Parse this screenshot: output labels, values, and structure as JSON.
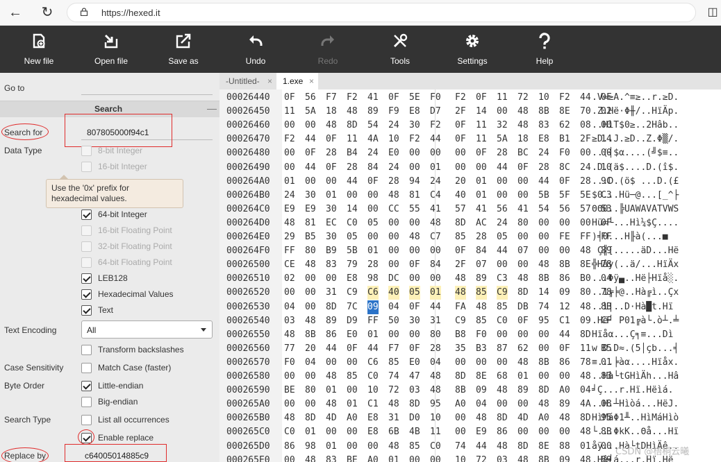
{
  "browser": {
    "url": "https://hexed.it"
  },
  "toolbar": {
    "buttons": [
      {
        "label": "New file",
        "icon": "new-file-icon",
        "disabled": false
      },
      {
        "label": "Open file",
        "icon": "open-file-icon",
        "disabled": false
      },
      {
        "label": "Save as",
        "icon": "save-as-icon",
        "disabled": false
      },
      {
        "label": "Undo",
        "icon": "undo-icon",
        "disabled": false
      },
      {
        "label": "Redo",
        "icon": "redo-icon",
        "disabled": true
      },
      {
        "label": "Tools",
        "icon": "tools-icon",
        "disabled": false
      },
      {
        "label": "Settings",
        "icon": "gear-icon",
        "disabled": false
      },
      {
        "label": "Help",
        "icon": "help-icon",
        "disabled": false
      }
    ]
  },
  "sidebar": {
    "goto_label": "Go to",
    "search_section": "Search",
    "collapse_symbol": "—",
    "search_for_label": "Search for",
    "search_for_value": "807805000f94c1",
    "data_type_label": "Data Type",
    "tooltip": "Use the '0x' prefix for hexadecimal values.",
    "data_types": [
      {
        "label": "8-bit Integer",
        "checked": false,
        "disabled": true
      },
      {
        "label": "16-bit Integer",
        "checked": false,
        "disabled": true
      },
      {
        "label": "64-bit Integer",
        "checked": true,
        "disabled": false
      },
      {
        "label": "16-bit Floating Point",
        "checked": false,
        "disabled": true
      },
      {
        "label": "32-bit Floating Point",
        "checked": false,
        "disabled": true
      },
      {
        "label": "64-bit Floating Point",
        "checked": false,
        "disabled": true
      },
      {
        "label": "LEB128",
        "checked": true,
        "disabled": false
      },
      {
        "label": "Hexadecimal Values",
        "checked": true,
        "disabled": false
      },
      {
        "label": "Text",
        "checked": true,
        "disabled": false
      }
    ],
    "text_encoding_label": "Text Encoding",
    "text_encoding_value": "All",
    "transform_backslashes": "Transform backslashes",
    "case_sensitivity_label": "Case Sensitivity",
    "match_case": "Match Case (faster)",
    "byte_order_label": "Byte Order",
    "little_endian": "Little-endian",
    "big_endian": "Big-endian",
    "search_type_label": "Search Type",
    "list_all": "List all occurrences",
    "enable_replace": "Enable replace",
    "replace_by_label": "Replace by",
    "replace_by_value": "c64005014885c9"
  },
  "tabs": [
    {
      "label": "-Untitled-",
      "close": "×"
    },
    {
      "label": "1.exe",
      "close": "×"
    }
  ],
  "hex": {
    "rows": [
      {
        "addr": "00026440",
        "bytes": [
          "0F",
          "56",
          "F7",
          "F2",
          "41",
          "0F",
          "5E",
          "F0",
          "F2",
          "0F",
          "11",
          "72",
          "10",
          "F2",
          "44",
          "0F"
        ],
        "ascii": ".V≈≥A.^≡≥..r.≥D."
      },
      {
        "addr": "00026450",
        "bytes": [
          "11",
          "5A",
          "18",
          "48",
          "89",
          "F9",
          "E8",
          "D7",
          "2F",
          "14",
          "00",
          "48",
          "8B",
          "8E",
          "70",
          "02"
        ],
        "ascii": ".Z.Hë·Φ╫/..HïÄp."
      },
      {
        "addr": "00026460",
        "bytes": [
          "00",
          "00",
          "48",
          "8D",
          "54",
          "24",
          "30",
          "F2",
          "0F",
          "11",
          "32",
          "48",
          "83",
          "62",
          "08",
          "00"
        ],
        "ascii": "..HìT$0≥..2Hâb.."
      },
      {
        "addr": "00026470",
        "bytes": [
          "F2",
          "44",
          "0F",
          "11",
          "4A",
          "10",
          "F2",
          "44",
          "0F",
          "11",
          "5A",
          "18",
          "E8",
          "B1",
          "2F",
          "14"
        ],
        "ascii": "≥D..J.≥D..Z.Φ▒/."
      },
      {
        "addr": "00026480",
        "bytes": [
          "00",
          "0F",
          "28",
          "B4",
          "24",
          "E0",
          "00",
          "00",
          "00",
          "0F",
          "28",
          "BC",
          "24",
          "F0",
          "00",
          "00"
        ],
        "ascii": "..(┤$α....(╝$≡.."
      },
      {
        "addr": "00026490",
        "bytes": [
          "00",
          "44",
          "0F",
          "28",
          "84",
          "24",
          "00",
          "01",
          "00",
          "00",
          "44",
          "0F",
          "28",
          "8C",
          "24",
          "10"
        ],
        "ascii": ".D.(ä$....D.(î$."
      },
      {
        "addr": "000264A0",
        "bytes": [
          "01",
          "00",
          "00",
          "44",
          "0F",
          "28",
          "94",
          "24",
          "20",
          "01",
          "00",
          "00",
          "44",
          "0F",
          "28",
          "9C"
        ],
        "ascii": "...D.(ö$ ...D.(£"
      },
      {
        "addr": "000264B0",
        "bytes": [
          "24",
          "30",
          "01",
          "00",
          "00",
          "48",
          "81",
          "C4",
          "40",
          "01",
          "00",
          "00",
          "5B",
          "5F",
          "5E",
          "C3"
        ],
        "ascii": "$0...Hü─@...[_^├"
      },
      {
        "addr": "000264C0",
        "bytes": [
          "E9",
          "E9",
          "30",
          "14",
          "00",
          "CC",
          "55",
          "41",
          "57",
          "41",
          "56",
          "41",
          "54",
          "56",
          "57",
          "53"
        ],
        "ascii": "ΘΘ0..╠UAWAVATVWS"
      },
      {
        "addr": "000264D0",
        "bytes": [
          "48",
          "81",
          "EC",
          "C0",
          "05",
          "00",
          "00",
          "48",
          "8D",
          "AC",
          "24",
          "80",
          "00",
          "00",
          "00",
          "0F"
        ],
        "ascii": "Hü∞└...Hì¼$Ç...."
      },
      {
        "addr": "000264E0",
        "bytes": [
          "29",
          "B5",
          "30",
          "05",
          "00",
          "00",
          "48",
          "C7",
          "85",
          "28",
          "05",
          "00",
          "00",
          "FE",
          "FF",
          "FF"
        ],
        "ascii": ")╡0...H╟à(...■  "
      },
      {
        "addr": "000264F0",
        "bytes": [
          "FF",
          "80",
          "B9",
          "5B",
          "01",
          "00",
          "00",
          "00",
          "0F",
          "84",
          "44",
          "07",
          "00",
          "00",
          "48",
          "89"
        ],
        "ascii": " Ç╣[.....äD...Hë"
      },
      {
        "addr": "00026500",
        "bytes": [
          "CE",
          "48",
          "83",
          "79",
          "28",
          "00",
          "0F",
          "84",
          "2F",
          "07",
          "00",
          "00",
          "48",
          "8B",
          "8E",
          "78"
        ],
        "ascii": "╬Hây(..ä/...HïÄx"
      },
      {
        "addr": "00026510",
        "bytes": [
          "02",
          "00",
          "00",
          "E8",
          "98",
          "DC",
          "00",
          "00",
          "48",
          "89",
          "C3",
          "48",
          "8B",
          "86",
          "B0",
          "04"
        ],
        "ascii": "...Φÿ▄..Hë├Hïå░."
      },
      {
        "addr": "00026520",
        "bytes": [
          "00",
          "00",
          "31",
          "C9",
          "C6",
          "40",
          "05",
          "01",
          "48",
          "85",
          "C9",
          "8D",
          "14",
          "09",
          "80",
          "78"
        ],
        "ascii": "..1╔╞@..Hà╔ì..Çx"
      },
      {
        "addr": "00026530",
        "bytes": [
          "04",
          "00",
          "8D",
          "7C",
          "09",
          "04",
          "0F",
          "44",
          "FA",
          "48",
          "85",
          "DB",
          "74",
          "12",
          "48",
          "8B"
        ],
        "ascii": "..ì|..D·Hà█t.Hï"
      },
      {
        "addr": "00026540",
        "bytes": [
          "03",
          "48",
          "89",
          "D9",
          "FF",
          "50",
          "30",
          "31",
          "C9",
          "85",
          "C0",
          "0F",
          "95",
          "C1",
          "09",
          "CF"
        ],
        "ascii": ".Hë┘ P01╔à└.ò┴.╧"
      },
      {
        "addr": "00026550",
        "bytes": [
          "48",
          "8B",
          "86",
          "E0",
          "01",
          "00",
          "00",
          "80",
          "B8",
          "F0",
          "00",
          "00",
          "00",
          "44",
          "8D"
        ],
        "ascii": "Hïåα...Ç╕≡...Dì"
      },
      {
        "addr": "00026560",
        "bytes": [
          "77",
          "20",
          "44",
          "0F",
          "44",
          "F7",
          "0F",
          "28",
          "35",
          "B3",
          "87",
          "62",
          "00",
          "0F",
          "11",
          "B5"
        ],
        "ascii": "w D.D≈.(5│çb...╡"
      },
      {
        "addr": "00026570",
        "bytes": [
          "F0",
          "04",
          "00",
          "00",
          "C6",
          "85",
          "E0",
          "04",
          "00",
          "00",
          "00",
          "48",
          "8B",
          "86",
          "78",
          "01"
        ],
        "ascii": "≡...╞àα....Hïåx."
      },
      {
        "addr": "00026580",
        "bytes": [
          "00",
          "00",
          "48",
          "85",
          "C0",
          "74",
          "47",
          "48",
          "8D",
          "8E",
          "68",
          "01",
          "00",
          "00",
          "48",
          "83"
        ],
        "ascii": "..Hà└tGHìÄh...Hâ"
      },
      {
        "addr": "00026590",
        "bytes": [
          "BE",
          "80",
          "01",
          "00",
          "10",
          "72",
          "03",
          "48",
          "8B",
          "09",
          "48",
          "89",
          "8D",
          "A0",
          "04"
        ],
        "ascii": "╛Ç...r.Hï.Hëìá."
      },
      {
        "addr": "000265A0",
        "bytes": [
          "00",
          "00",
          "48",
          "01",
          "C1",
          "48",
          "8D",
          "95",
          "A0",
          "04",
          "00",
          "00",
          "48",
          "89",
          "4A",
          "08"
        ],
        "ascii": "..H.┴Hìòá...HëJ."
      },
      {
        "addr": "000265B0",
        "bytes": [
          "48",
          "8D",
          "4D",
          "A0",
          "E8",
          "31",
          "D0",
          "10",
          "00",
          "48",
          "8D",
          "4D",
          "A0",
          "48",
          "8D",
          "95"
        ],
        "ascii": "HìMáΦ1╨..HìMáHìò"
      },
      {
        "addr": "000265C0",
        "bytes": [
          "C0",
          "01",
          "00",
          "00",
          "E8",
          "6B",
          "4B",
          "11",
          "00",
          "E9",
          "86",
          "00",
          "00",
          "00",
          "48",
          "8B"
        ],
        "ascii": "└...ΦkK..Θå...Hï"
      },
      {
        "addr": "000265D0",
        "bytes": [
          "86",
          "98",
          "01",
          "00",
          "00",
          "48",
          "85",
          "C0",
          "74",
          "44",
          "48",
          "8D",
          "8E",
          "88",
          "01",
          "00"
        ],
        "ascii": "åÿ...Hà└tDHìÄê.."
      },
      {
        "addr": "000265E0",
        "bytes": [
          "00",
          "48",
          "83",
          "BE",
          "A0",
          "01",
          "00",
          "00",
          "10",
          "72",
          "03",
          "48",
          "8B",
          "09",
          "48",
          "89"
        ],
        "ascii": ".Hâ╛á...r.Hï.Hë"
      }
    ],
    "highlight": {
      "row": 14,
      "from": 4,
      "to": 10
    },
    "cursor": {
      "row": 15,
      "col": 4
    }
  },
  "watermark": "CSDN @梧桐云曦"
}
